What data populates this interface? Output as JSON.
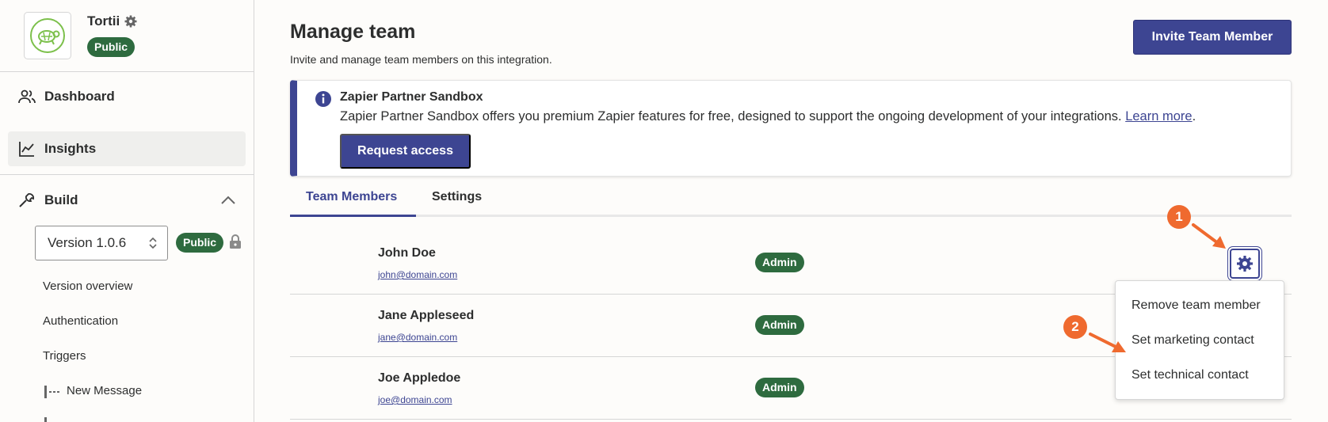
{
  "sidebar": {
    "app_name": "Tortii",
    "app_badge": "Public",
    "nav": {
      "dashboard": "Dashboard",
      "insights": "Insights",
      "build": "Build"
    },
    "version_select": "Version 1.0.6",
    "version_badge": "Public",
    "sub_items": {
      "overview": "Version overview",
      "auth": "Authentication",
      "triggers": "Triggers",
      "new_message": "New Message"
    }
  },
  "main": {
    "title": "Manage team",
    "subtitle": "Invite and manage team members on this integration.",
    "invite_label": "Invite Team Member",
    "alert": {
      "title": "Zapier Partner Sandbox",
      "body": "Zapier Partner Sandbox offers you premium Zapier features for free, designed to support the ongoing development of your integrations. ",
      "link": "Learn more",
      "period": ".",
      "button": "Request access"
    },
    "tabs": [
      "Team Members",
      "Settings"
    ],
    "members": [
      {
        "name": "John Doe",
        "email": "john@domain.com",
        "role": "Admin"
      },
      {
        "name": "Jane Appleseed",
        "email": "jane@domain.com",
        "role": "Admin"
      },
      {
        "name": "Joe Appledoe",
        "email": "joe@domain.com",
        "role": "Admin"
      }
    ],
    "menu": [
      "Remove team member",
      "Set marketing contact",
      "Set technical contact"
    ]
  },
  "annotations": {
    "step1": "1",
    "step2": "2"
  },
  "colors": {
    "accent": "#3d4592",
    "badge_green": "#2e6b3f",
    "annotation_orange": "#ef6a2f"
  }
}
